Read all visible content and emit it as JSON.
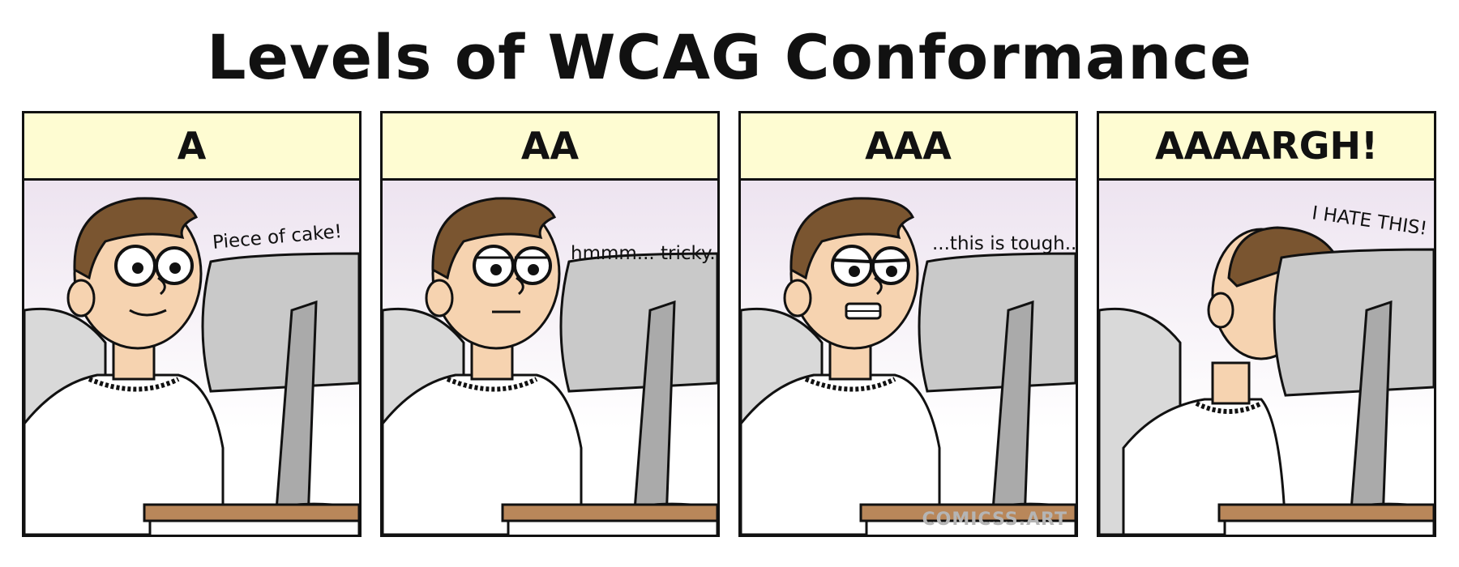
{
  "title": "Levels of WCAG Conformance",
  "panels": [
    {
      "label": "A",
      "speech": "Piece of cake!"
    },
    {
      "label": "AA",
      "speech": "hmmm... tricky..."
    },
    {
      "label": "AAA",
      "speech": "...this is tough..."
    },
    {
      "label": "AAAARGH!",
      "speech": "I HATE THIS!"
    }
  ],
  "watermark": "COMICSS.ART",
  "colors": {
    "header_bg": "#fefcd2",
    "hair": "#7a5530",
    "skin": "#f6d3b0",
    "monitor": "#c4c4c4",
    "desk": "#b9875a"
  }
}
